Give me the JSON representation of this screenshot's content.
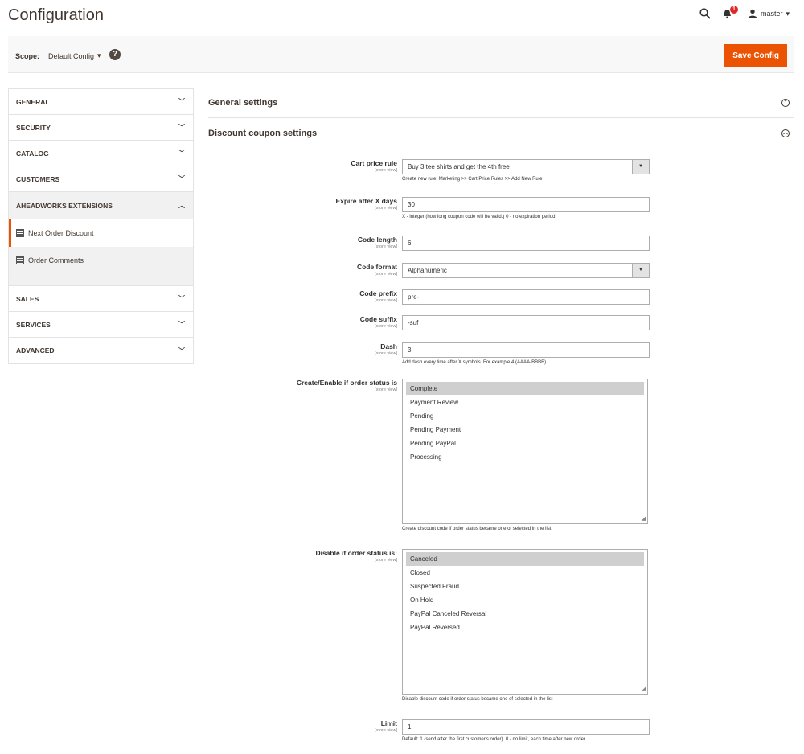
{
  "header": {
    "title": "Configuration",
    "notifications_count": "1",
    "user": "master"
  },
  "scope": {
    "label": "Scope:",
    "value": "Default Config",
    "save_label": "Save Config"
  },
  "sidebar": {
    "items": [
      {
        "label": "GENERAL"
      },
      {
        "label": "SECURITY"
      },
      {
        "label": "CATALOG"
      },
      {
        "label": "CUSTOMERS"
      },
      {
        "label": "AHEADWORKS EXTENSIONS"
      },
      {
        "label": "SALES"
      },
      {
        "label": "SERVICES"
      },
      {
        "label": "ADVANCED"
      }
    ],
    "subitems": [
      {
        "label": "Next Order Discount"
      },
      {
        "label": "Order Comments"
      }
    ]
  },
  "sections": {
    "general": "General settings",
    "discount": "Discount coupon settings"
  },
  "form": {
    "store_view": "[store view]",
    "cart_price_rule": {
      "label": "Cart price rule",
      "value": "Buy 3 tee shirts and get the 4th free",
      "note": "Create new rule: Marketing >> Cart Price Rules >> Add New Rule"
    },
    "expire": {
      "label": "Expire after X days",
      "value": "30",
      "note": "X - integer (how long coupon code will be valid.) 0 - no expiration period"
    },
    "code_length": {
      "label": "Code length",
      "value": "6"
    },
    "code_format": {
      "label": "Code format",
      "value": "Alphanumeric"
    },
    "code_prefix": {
      "label": "Code prefix",
      "value": "pre-"
    },
    "code_suffix": {
      "label": "Code suffix",
      "value": "-suf"
    },
    "dash": {
      "label": "Dash",
      "value": "3",
      "note": "Add dash every time after X symbols. For example 4 (AAAA-BBBB)"
    },
    "create_status": {
      "label": "Create/Enable if order status is",
      "options": [
        "Complete",
        "Payment Review",
        "Pending",
        "Pending Payment",
        "Pending PayPal",
        "Processing"
      ],
      "note": "Create discount code if order status became one of selected in the list"
    },
    "disable_status": {
      "label": "Disable if order status is:",
      "options": [
        "Canceled",
        "Closed",
        "Suspected Fraud",
        "On Hold",
        "PayPal Canceled Reversal",
        "PayPal Reversed"
      ],
      "note": "Disable discount code if order status became one of selected in the list"
    },
    "limit": {
      "label": "Limit",
      "value": "1",
      "note": "Default: 1 (send after the first customer's order). 0 - no limit, each time after new order"
    }
  }
}
